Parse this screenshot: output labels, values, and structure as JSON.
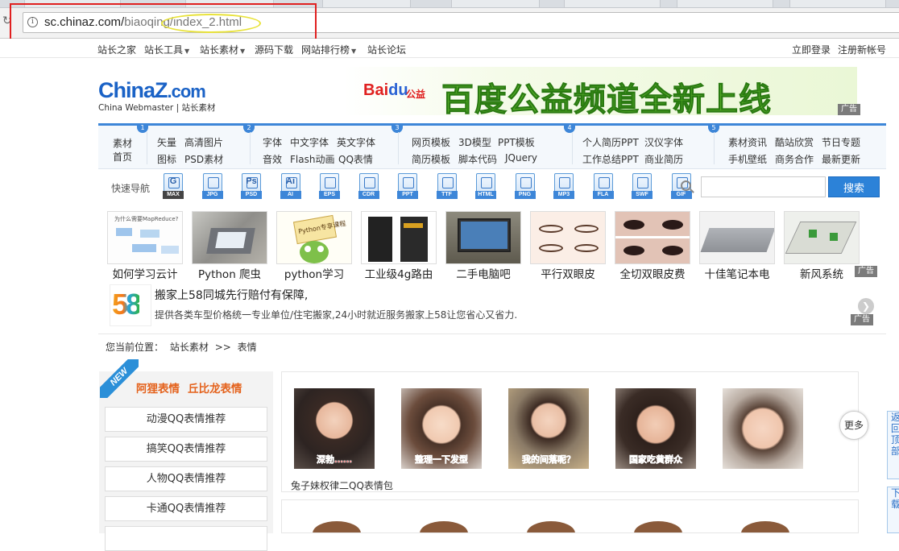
{
  "browser": {
    "url_host": "sc.chinaz.com/",
    "url_path": "biaoqing/index_2.html"
  },
  "toplinks": {
    "left": [
      "站长之家",
      "站长工具",
      "站长素材",
      "源码下载",
      "网站排行榜",
      "站长论坛"
    ],
    "login": "立即登录",
    "register": "注册新帐号"
  },
  "logo": {
    "main": "ChinaZ",
    "com": ".com",
    "sub": "China Webmaster  |  站长素材"
  },
  "banner": {
    "brand_bai": "Bai",
    "brand_du": "du",
    "brand_gongyi": "公益",
    "slogan": "百度公益频道全新上线",
    "ad": "广告"
  },
  "catnav": {
    "nums": [
      "1",
      "2",
      "3",
      "4",
      "5"
    ],
    "home_1": "素材",
    "home_2": "首页",
    "g1": [
      "矢量",
      "高清图片",
      "图标",
      "PSD素材"
    ],
    "g2": [
      "字体",
      "中文字体",
      "英文字体",
      "音效",
      "Flash动画",
      "QQ表情"
    ],
    "g3": [
      "网页模板",
      "3D模型",
      "PPT模板",
      "简历模板",
      "脚本代码",
      "JQuery"
    ],
    "g4": [
      "个人简历PPT",
      "汉仪字体",
      "工作总结PPT",
      "商业简历"
    ],
    "g5": [
      "素材资讯",
      "酷站欣赏",
      "节日专题",
      "手机壁纸",
      "商务合作",
      "最新更新"
    ]
  },
  "quicknav": {
    "label": "快速导航",
    "icons": [
      {
        "tag": "MAX",
        "glyph": "G",
        "icon": "max-file-icon"
      },
      {
        "tag": "JPG",
        "glyph": "",
        "icon": "jpg-file-icon"
      },
      {
        "tag": "PSD",
        "glyph": "Ps",
        "icon": "psd-file-icon"
      },
      {
        "tag": "AI",
        "glyph": "Ai",
        "icon": "ai-file-icon"
      },
      {
        "tag": "EPS",
        "glyph": "",
        "icon": "eps-file-icon"
      },
      {
        "tag": "CDR",
        "glyph": "",
        "icon": "cdr-file-icon"
      },
      {
        "tag": "PPT",
        "glyph": "",
        "icon": "ppt-file-icon"
      },
      {
        "tag": "TTF",
        "glyph": "",
        "icon": "ttf-file-icon"
      },
      {
        "tag": "HTML",
        "glyph": "",
        "icon": "html-file-icon"
      },
      {
        "tag": "PNG",
        "glyph": "",
        "icon": "png-file-icon"
      },
      {
        "tag": "MP3",
        "glyph": "",
        "icon": "mp3-file-icon"
      },
      {
        "tag": "FLA",
        "glyph": "",
        "icon": "fla-file-icon"
      },
      {
        "tag": "SWF",
        "glyph": "",
        "icon": "swf-file-icon"
      },
      {
        "tag": "GIF",
        "glyph": "",
        "icon": "gif-file-icon"
      }
    ],
    "search_value": "",
    "search_button": "搜索"
  },
  "imgads": {
    "captions": [
      "如何学习云计",
      "Python 爬虫",
      "python学习",
      "工业级4g路由",
      "二手电脑吧",
      "平行双眼皮",
      "全切双眼皮费",
      "十佳笔记本电",
      "新风系统"
    ],
    "thumb1_text": "为什么需要MapReduce?",
    "thumb3_text": "Python专享课程",
    "ad": "广告"
  },
  "ad58": {
    "logo": "58",
    "line1": "搬家上58同城先行赔付有保障,",
    "line2": "提供各类车型价格统一专业单位/住宅搬家,24小时就近服务搬家上58让您省心又省力.",
    "ad": "广告"
  },
  "breadcrumb": {
    "label": "您当前位置：",
    "home": "站长素材",
    "sep": ">>",
    "current": "表情"
  },
  "sidebar": {
    "badge": "NEW",
    "hot1": "阿狸表情",
    "hot2": "丘比龙表情",
    "items": [
      "动漫QQ表情推荐",
      "搞笑QQ表情推荐",
      "人物QQ表情推荐",
      "卡通QQ表情推荐"
    ]
  },
  "panel": {
    "emoji_texts": [
      "深勃……",
      "整理一下发型",
      "我的间落呢？",
      "国家吃黄群众",
      ""
    ],
    "title": "兔子妹权律二QQ表情包",
    "more": "更多"
  },
  "floats": {
    "back_top": "返回顶部",
    "down": "下载"
  },
  "colors": {
    "brand_blue": "#1a62c6",
    "accent_orange": "#e4621c",
    "button_blue": "#2c82d8",
    "annotation_red": "#e02020",
    "annotation_yellow": "#e8e23a"
  }
}
